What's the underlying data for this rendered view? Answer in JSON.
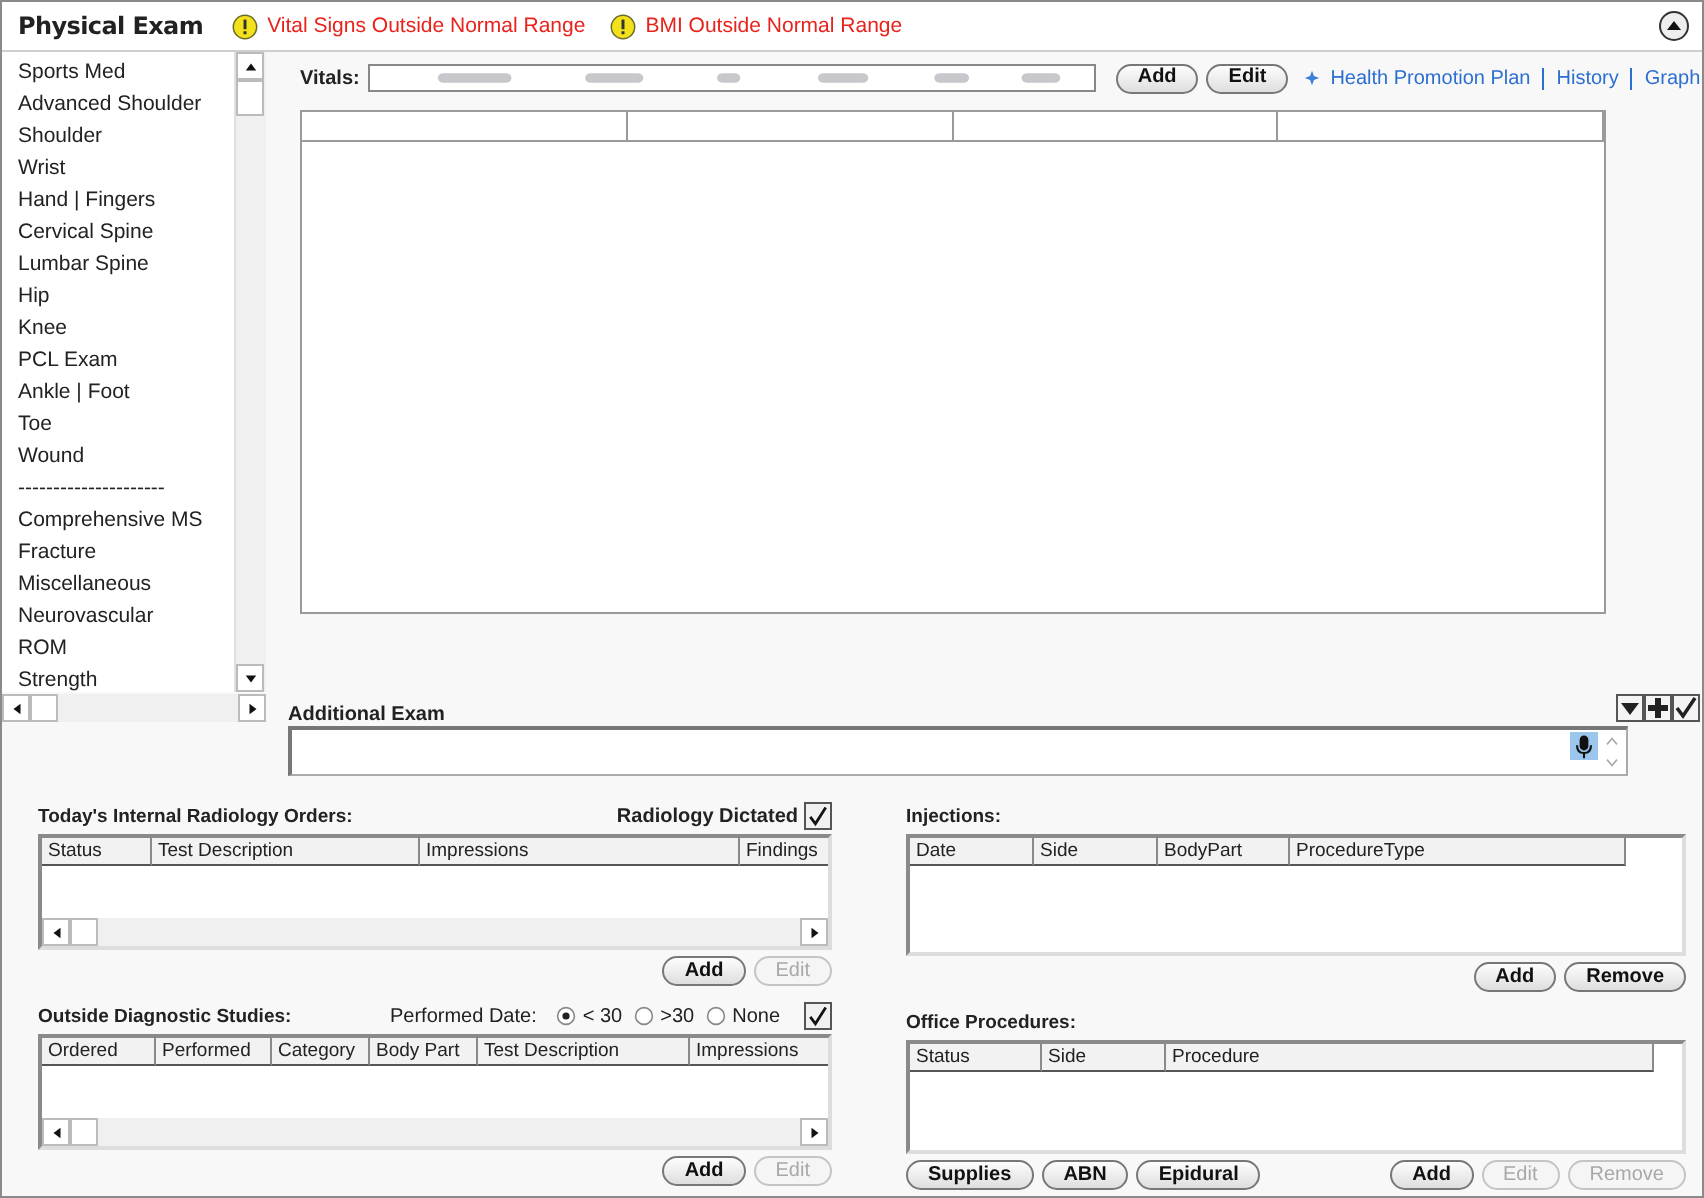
{
  "header": {
    "title": "Physical Exam",
    "alerts": [
      "Vital Signs Outside Normal Range",
      "BMI Outside Normal Range"
    ]
  },
  "exam_list": {
    "items": [
      "Sports Med",
      "Advanced Shoulder",
      "Shoulder",
      "Wrist",
      "Hand | Fingers",
      "Cervical Spine",
      "Lumbar Spine",
      "Hip",
      "Knee",
      "PCL Exam",
      "Ankle | Foot",
      "Toe",
      "Wound",
      "---------------------",
      "Comprehensive MS",
      "Fracture",
      "Miscellaneous",
      "Neurovascular",
      "ROM",
      "Strength"
    ]
  },
  "vitals": {
    "label": "Vitals:",
    "buttons": [
      {
        "label": "Add",
        "disabled": false
      },
      {
        "label": "Edit",
        "disabled": false
      }
    ],
    "links": [
      "Health Promotion Plan",
      "History",
      "Graph"
    ]
  },
  "additional_exam": {
    "label": "Additional Exam"
  },
  "radiology_orders": {
    "title": "Today's Internal Radiology Orders:",
    "dictated": {
      "label": "Radiology Dictated",
      "checked": true
    },
    "columns": [
      "Status",
      "Test Description",
      "Impressions",
      "Findings"
    ],
    "buttons": [
      {
        "label": "Add",
        "disabled": false
      },
      {
        "label": "Edit",
        "disabled": true
      }
    ]
  },
  "outside_studies": {
    "title": "Outside Diagnostic Studies:",
    "filter_label": "Performed Date:",
    "options": [
      {
        "label": "< 30",
        "selected": true
      },
      {
        "label": ">30",
        "selected": false
      },
      {
        "label": "None",
        "selected": false
      }
    ],
    "checked": true,
    "columns": [
      "Ordered",
      "Performed",
      "Category",
      "Body Part",
      "Test Description",
      "Impressions"
    ],
    "buttons": [
      {
        "label": "Add",
        "disabled": false
      },
      {
        "label": "Edit",
        "disabled": true
      }
    ]
  },
  "injections": {
    "title": "Injections:",
    "columns": [
      "Date",
      "Side",
      "BodyPart",
      "ProcedureType"
    ],
    "buttons": [
      {
        "label": "Add",
        "disabled": false
      },
      {
        "label": "Remove",
        "disabled": false
      }
    ]
  },
  "office_procedures": {
    "title": "Office Procedures:",
    "columns": [
      "Status",
      "Side",
      "Procedure"
    ],
    "extra_buttons": [
      "Supplies",
      "ABN",
      "Epidural"
    ],
    "buttons": [
      {
        "label": "Add",
        "disabled": false
      },
      {
        "label": "Edit",
        "disabled": true
      },
      {
        "label": "Remove",
        "disabled": true
      }
    ]
  }
}
